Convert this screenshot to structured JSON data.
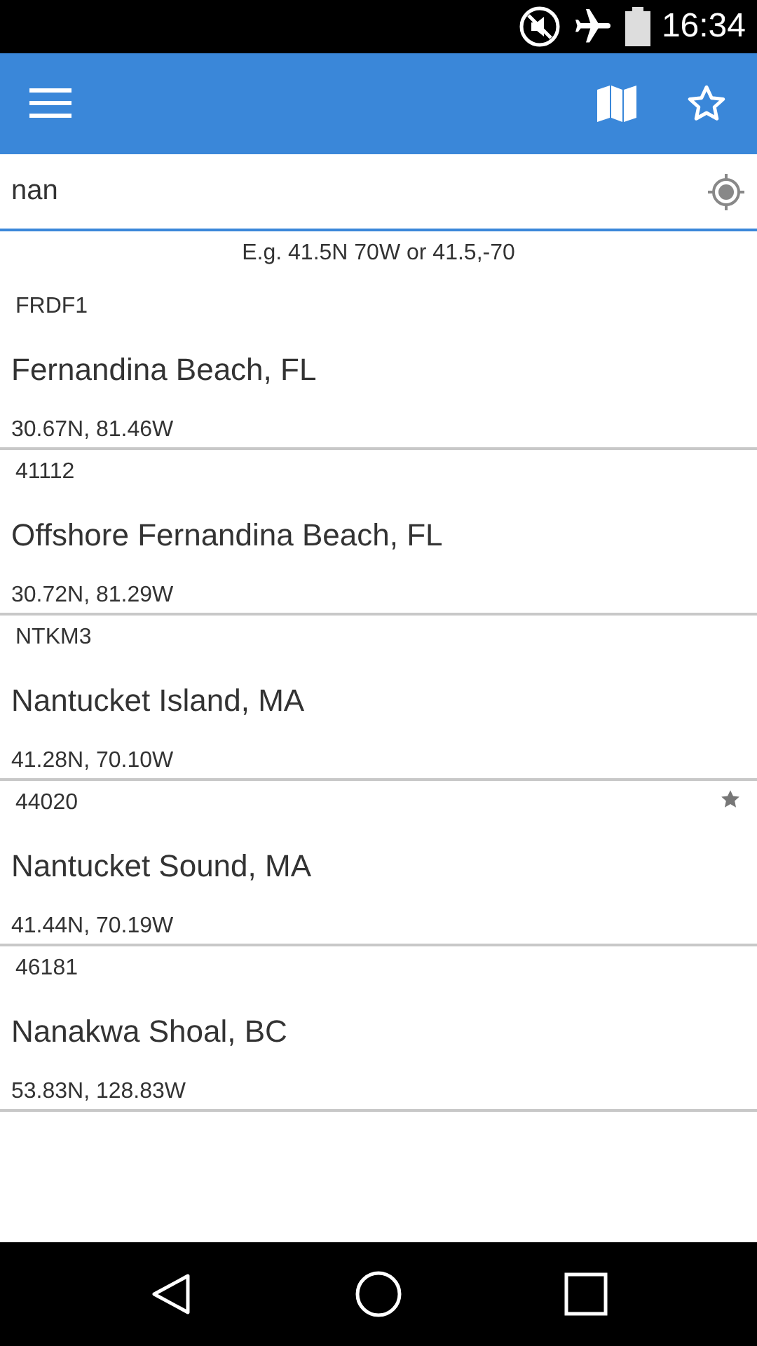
{
  "status_bar": {
    "time": "16:34"
  },
  "search": {
    "value": "nan",
    "hint": "E.g. 41.5N 70W or 41.5,-70"
  },
  "stations": [
    {
      "id": "FRDF1",
      "name": "Fernandina Beach, FL",
      "coords": "30.67N, 81.46W",
      "favorite": false
    },
    {
      "id": "41112",
      "name": "Offshore Fernandina Beach, FL",
      "coords": "30.72N, 81.29W",
      "favorite": false
    },
    {
      "id": "NTKM3",
      "name": "Nantucket Island, MA",
      "coords": "41.28N, 70.10W",
      "favorite": false
    },
    {
      "id": "44020",
      "name": "Nantucket Sound, MA",
      "coords": "41.44N, 70.19W",
      "favorite": true
    },
    {
      "id": "46181",
      "name": "Nanakwa Shoal, BC",
      "coords": "53.83N, 128.83W",
      "favorite": false
    }
  ]
}
